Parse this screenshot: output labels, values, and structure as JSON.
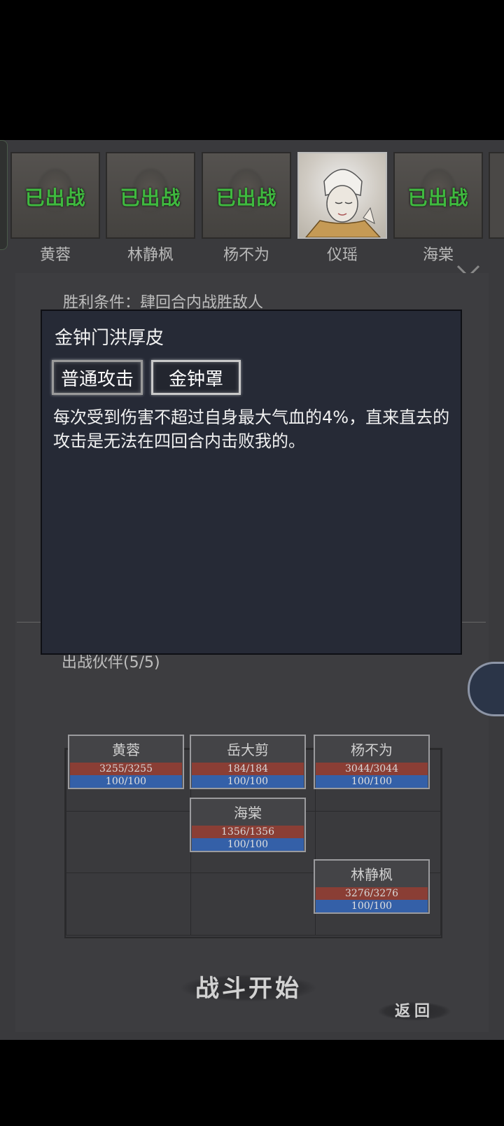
{
  "characters": [
    {
      "name": "黄蓉",
      "status": "已出战"
    },
    {
      "name": "林静枫",
      "status": "已出战"
    },
    {
      "name": "杨不为",
      "status": "已出战"
    },
    {
      "name": "仪瑶",
      "status": ""
    },
    {
      "name": "海棠",
      "status": "已出战"
    }
  ],
  "background": {
    "condition_text": "胜利条件：肆回合内战胜敌人",
    "party_label": "出战伙伴(5/5)"
  },
  "dialog": {
    "title": "金钟门洪厚皮",
    "skills": [
      "普通攻击",
      "金钟罩"
    ],
    "selected_skill": "金钟罩",
    "description": "每次受到伤害不超过自身最大气血的4%，直来直去的攻击是无法在四回合内击败我的。"
  },
  "formation": [
    {
      "name": "黄蓉",
      "hp": "3255/3255",
      "mp": "100/100"
    },
    {
      "name": "岳大剪",
      "hp": "184/184",
      "mp": "100/100"
    },
    {
      "name": "杨不为",
      "hp": "3044/3044",
      "mp": "100/100"
    },
    {
      "name": "海棠",
      "hp": "1356/1356",
      "mp": "100/100"
    },
    {
      "name": "林静枫",
      "hp": "3276/3276",
      "mp": "100/100"
    }
  ],
  "buttons": {
    "start": "战斗开始",
    "back": "返回"
  },
  "colors": {
    "deployed": "#3fb93f",
    "hp_bar": "#8a3e35",
    "mp_bar": "#3460a8",
    "dialog_bg": "#262a36"
  }
}
